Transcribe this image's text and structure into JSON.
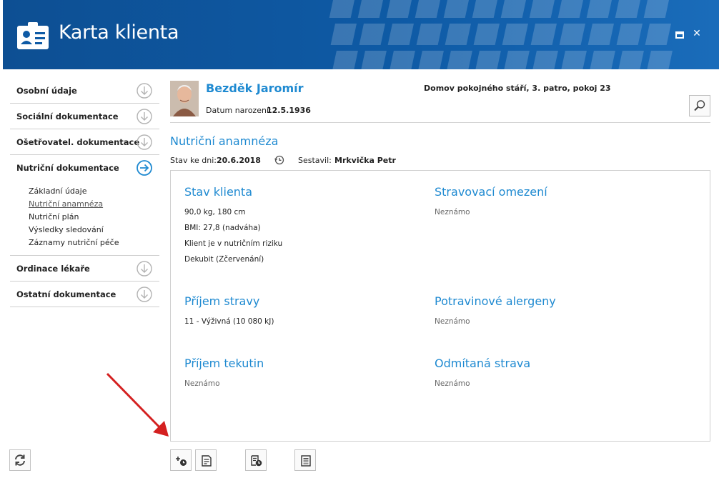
{
  "window": {
    "title": "Karta klienta",
    "maximize_label": "maximize",
    "close_label": "✕"
  },
  "sidebar": {
    "items": [
      {
        "label": "Osobní údaje",
        "expanded": false
      },
      {
        "label": "Sociální dokumentace",
        "expanded": false
      },
      {
        "label": "Ošetřovatel. dokumentace",
        "expanded": false
      },
      {
        "label": "Nutriční dokumentace",
        "expanded": true
      },
      {
        "label": "Ordinace lékaře",
        "expanded": false
      },
      {
        "label": "Ostatní dokumentace",
        "expanded": false
      }
    ],
    "subitems": [
      {
        "label": "Základní údaje",
        "active": false
      },
      {
        "label": "Nutriční anamnéza",
        "active": true
      },
      {
        "label": "Nutriční plán",
        "active": false
      },
      {
        "label": "Výsledky sledování",
        "active": false
      },
      {
        "label": "Záznamy nutriční péče",
        "active": false
      }
    ]
  },
  "client": {
    "name": "Bezděk Jaromír",
    "dob_label": "Datum narození:",
    "dob": "12.5.1936",
    "location": "Domov pokojného stáří, 3. patro, pokoj 23"
  },
  "section": {
    "title": "Nutriční anamnéza",
    "stav_label": "Stav ke dni:",
    "stav_date": "20.6.2018",
    "sestavil_label": "Sestavil:",
    "sestavil": "Mrkvička Petr"
  },
  "panel": {
    "stav_klienta": {
      "title": "Stav klienta",
      "lines": [
        "90,0 kg, 180 cm",
        "BMI: 27,8 (nadváha)",
        "Klient je v nutričním riziku",
        "Dekubit (Zčervenání)"
      ]
    },
    "stravovaci_omezeni": {
      "title": "Stravovací omezení",
      "value": "Neznámo"
    },
    "prijem_stravy": {
      "title": "Příjem stravy",
      "value": "11 - Výživná (10 080 kJ)"
    },
    "potravinove_alergeny": {
      "title": "Potravinové alergeny",
      "value": "Neznámo"
    },
    "prijem_tekutin": {
      "title": "Příjem tekutin",
      "value": "Neznámo"
    },
    "odmitana_strava": {
      "title": "Odmítaná strava",
      "value": "Neznámo"
    }
  },
  "colors": {
    "header_bg": "#0e5aa5",
    "accent_blue": "#1f8ad1",
    "annotation_arrow": "#d42020"
  },
  "icons": {
    "header": "client-card-icon",
    "refresh": "refresh-icon",
    "search": "search-icon",
    "history": "history-icon",
    "toolbar": [
      "add-timed-record-icon",
      "edit-record-icon",
      "record-history-icon",
      "document-icon"
    ]
  }
}
